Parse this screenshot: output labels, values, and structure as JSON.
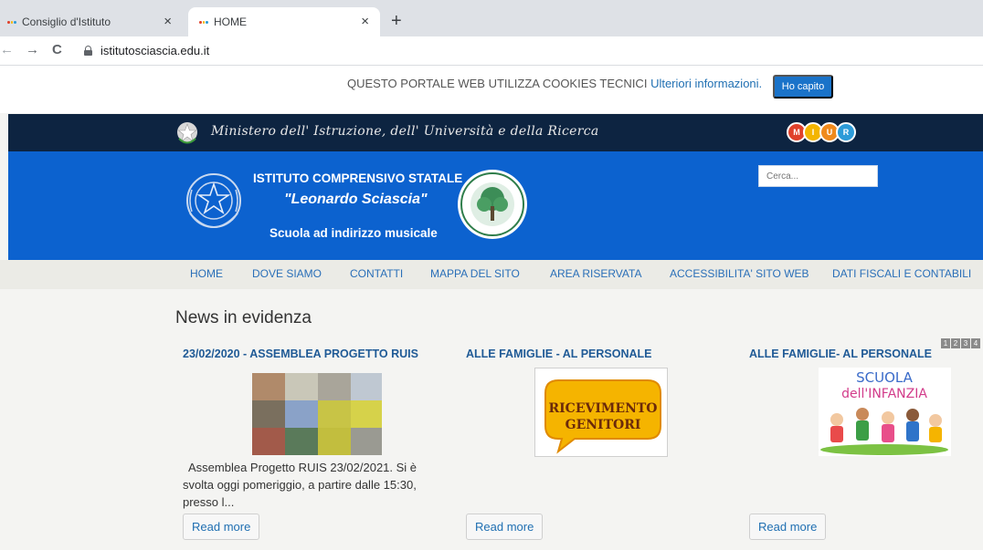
{
  "browser": {
    "tabs": [
      {
        "title": "Consiglio d'Istituto",
        "active": false
      },
      {
        "title": "HOME",
        "active": true
      }
    ],
    "close_glyph": "×",
    "new_tab_glyph": "+",
    "nav": {
      "back": "←",
      "forward": "→",
      "reload": "C"
    },
    "url": "istitutosciascia.edu.it"
  },
  "cookie_bar": {
    "text": "QUESTO PORTALE WEB UTILIZZA COOKIES TECNICI",
    "link": "Ulteriori informazioni.",
    "button": "Ho capito"
  },
  "ministry": {
    "name": "Ministero dell' Istruzione, dell' Università e della Ricerca",
    "logo_letters": [
      "M",
      "I",
      "U",
      "R"
    ],
    "logo_colors": [
      "#e0412b",
      "#f3b500",
      "#f08a1c",
      "#2c9bd8"
    ]
  },
  "header": {
    "line1": "ISTITUTO COMPRENSIVO STATALE",
    "line2": "\"Leonardo Sciascia\"",
    "line3": "Scuola ad indirizzo musicale",
    "search_placeholder": "Cerca..."
  },
  "nav": {
    "items": [
      "HOME",
      "DOVE SIAMO",
      "CONTATTI",
      "MAPPA DEL SITO",
      "AREA RISERVATA",
      "ACCESSIBILITA' SITO WEB",
      "DATI FISCALI E CONTABILI"
    ]
  },
  "news": {
    "section_title": "News in evidenza",
    "pager": [
      "1",
      "2",
      "3",
      "4"
    ],
    "items": [
      {
        "title": "23/02/2020 - ASSEMBLEA PROGETTO RUIS",
        "excerpt": "Assemblea Progetto RUIS 23/02/2021. Si è svolta oggi pomeriggio, a partire dalle 15:30, presso l...",
        "read_more": "Read more"
      },
      {
        "title": "ALLE FAMIGLIE - AL PERSONALE",
        "image_text": [
          "RICEVIMENTO",
          "GENITORI"
        ],
        "read_more": "Read more"
      },
      {
        "title": "ALLE FAMIGLIE- AL PERSONALE",
        "image_text": [
          "SCUOLA",
          "dell'INFANZIA"
        ],
        "read_more": "Read more"
      }
    ]
  },
  "colors": {
    "ministry_bar": "#0d2441",
    "header_blue": "#0c62cf",
    "link_blue": "#1f5a96"
  }
}
